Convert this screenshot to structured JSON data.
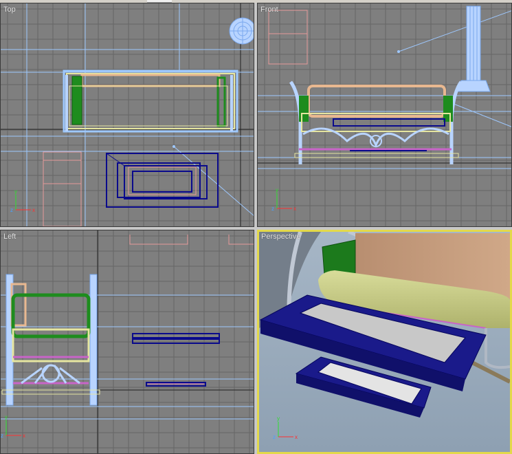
{
  "viewports": {
    "top": {
      "label": "Top"
    },
    "front": {
      "label": "Front"
    },
    "left": {
      "label": "Left"
    },
    "perspective": {
      "label": "Perspective"
    }
  },
  "axis_labels": {
    "x": "x",
    "y": "y",
    "z": "z"
  },
  "colors": {
    "viewport_bg": "#7f7f7f",
    "grid": "#666666",
    "home_grid": "#222222",
    "wire_light_blue": "#9ec8ff",
    "wire_green": "#1e8c1e",
    "wire_peach": "#e8b890",
    "wire_yellow": "#e6e6a0",
    "wire_navy": "#0a0a8c",
    "wire_magenta": "#c864c8",
    "wire_pink": "#e69a9a",
    "active_border": "#e3d94a"
  }
}
